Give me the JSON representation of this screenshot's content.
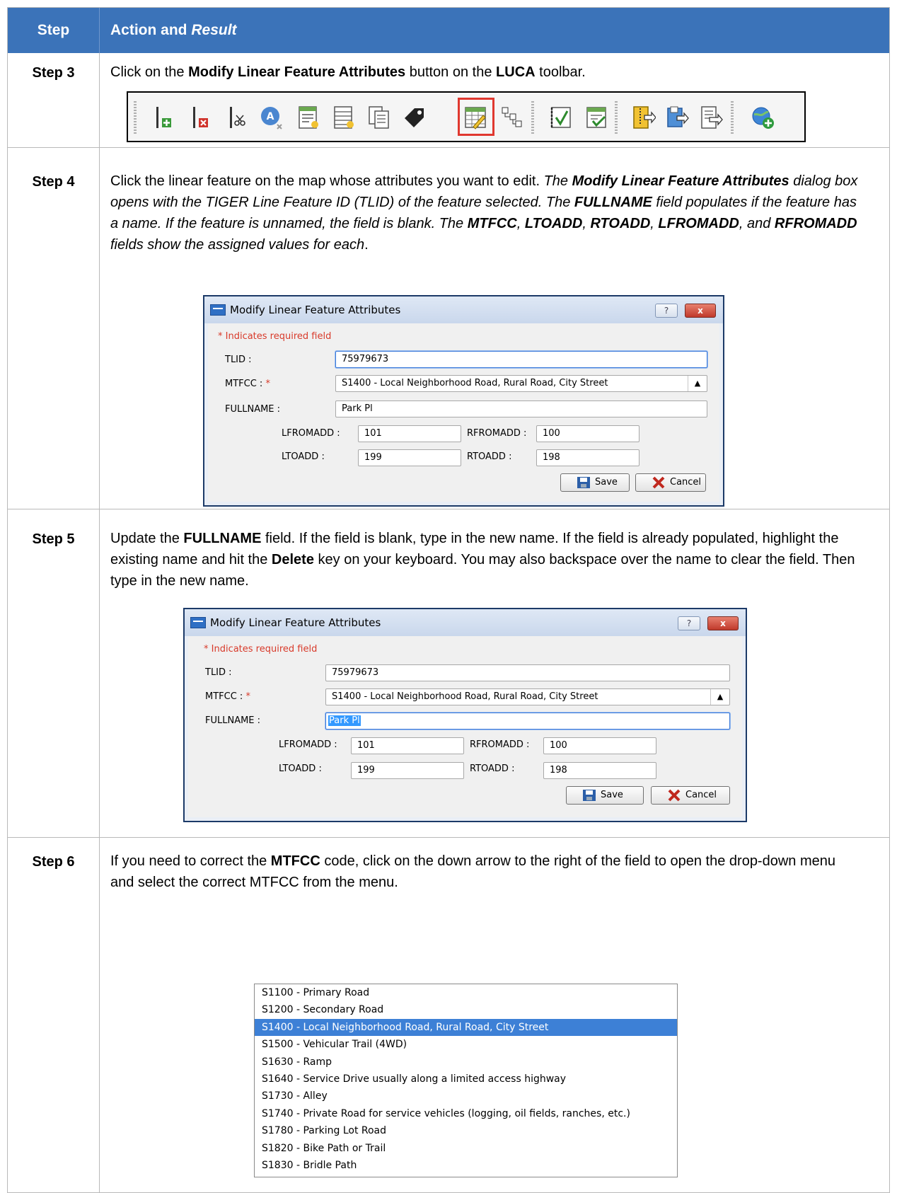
{
  "header": {
    "col1": "Step",
    "col2_plain": "Action and ",
    "col2_italic": "Result"
  },
  "step3": {
    "label": "Step 3",
    "t1": "Click on the ",
    "b1": "Modify Linear Feature Attributes",
    "t2": " button on the ",
    "b2": "LUCA",
    "t3": " toolbar.",
    "toolbar_icons": [
      "add-line-icon",
      "delete-line-icon",
      "split-line-icon",
      "add-label-icon",
      "attributes-form-icon",
      "table-form-icon",
      "copy-features-icon",
      "tag-icon",
      "modify-linear-feature-attributes-icon",
      "hierarchy-icon",
      "check-review-icon",
      "validate-checklist-icon",
      "zip-export-icon",
      "export-folder-icon",
      "export-doc-icon",
      "add-web-service-icon"
    ]
  },
  "step4": {
    "label": "Step 4",
    "t1": "Click the linear feature on the map whose attributes you want to edit. ",
    "i1": "The ",
    "bi1": "Modify Linear Feature Attributes",
    "i2": " dialog box opens with the TIGER Line Feature ID (TLID) of the feature selected. The ",
    "bi2": "FULLNAME",
    "i3": " field populates if the feature has a name. If the feature is unnamed, the field is blank. The ",
    "bi3": "MTFCC",
    "i4": ", ",
    "bi4": "LTOADD",
    "i5": ", ",
    "bi5": "RTOADD",
    "i6": ", ",
    "bi6": "LFROMADD",
    "i7": ", and ",
    "bi7": "RFROMADD",
    "i8": " fields show the assigned values for each",
    "t_end": "."
  },
  "step5": {
    "label": "Step 5",
    "t1": "Update the ",
    "b1": "FULLNAME",
    "t2": " field. If the field is blank, type in the new name. If the field is already populated, highlight the existing name and hit the ",
    "b2": "Delete",
    "t3": " key on your keyboard. You may also backspace over the name to clear the field. Then type in the new name."
  },
  "step6": {
    "label": "Step 6",
    "t1": "If you need to correct the ",
    "b1": "MTFCC",
    "t2": " code, click on the down arrow to the right of the field to open the drop-down menu and select the correct MTFCC from the menu."
  },
  "dialog": {
    "title": "Modify Linear Feature Attributes",
    "help": "?",
    "close": "x",
    "required_note": "* Indicates required field",
    "tlid_label": "TLID :",
    "tlid_value": "75979673",
    "mtfcc_label": "MTFCC : ",
    "mtfcc_star": "*",
    "mtfcc_value": "S1400 - Local Neighborhood Road, Rural Road, City Street",
    "fullname_label": "FULLNAME :",
    "fullname_value": "Park Pl",
    "lfromadd_label": "LFROMADD :",
    "lfromadd_value": "101",
    "rfromadd_label": "RFROMADD :",
    "rfromadd_value": "100",
    "ltoadd_label": "LTOADD :",
    "ltoadd_value": "199",
    "rtoadd_label": "RTOADD :",
    "rtoadd_value": "198",
    "save": "Save",
    "cancel": "Cancel"
  },
  "mtfcc_options": [
    "S1100 - Primary Road",
    "S1200 - Secondary Road",
    "S1400 - Local Neighborhood Road, Rural Road, City Street",
    "S1500 - Vehicular Trail (4WD)",
    "S1630 - Ramp",
    "S1640 - Service Drive usually along a limited access highway",
    "S1730 - Alley",
    "S1740 - Private Road for service vehicles (logging, oil fields, ranches, etc.)",
    "S1780 - Parking Lot Road",
    "S1820 - Bike Path or Trail",
    "S1830 - Bridle Path"
  ],
  "mtfcc_selected_index": 2,
  "colors": {
    "header": "#3b73b9",
    "highlight": "#e0382f",
    "list_selected": "#3d80d6",
    "required": "#d83a2a"
  }
}
